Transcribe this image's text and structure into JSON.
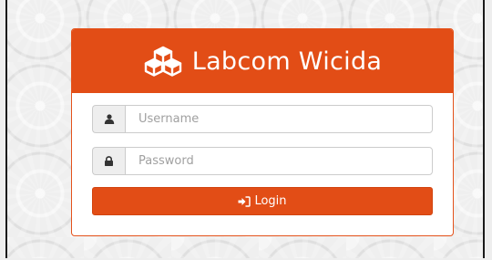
{
  "app": {
    "title": "Labcom Wicida"
  },
  "login_form": {
    "username": {
      "placeholder": "Username",
      "value": "",
      "icon": "user-icon"
    },
    "password": {
      "placeholder": "Password",
      "value": "",
      "icon": "lock-icon"
    },
    "submit": {
      "label": "Login",
      "icon": "sign-in-icon"
    }
  },
  "colors": {
    "accent": "#e24d16",
    "background": "#efefef",
    "addon_bg": "#eeeeee"
  }
}
